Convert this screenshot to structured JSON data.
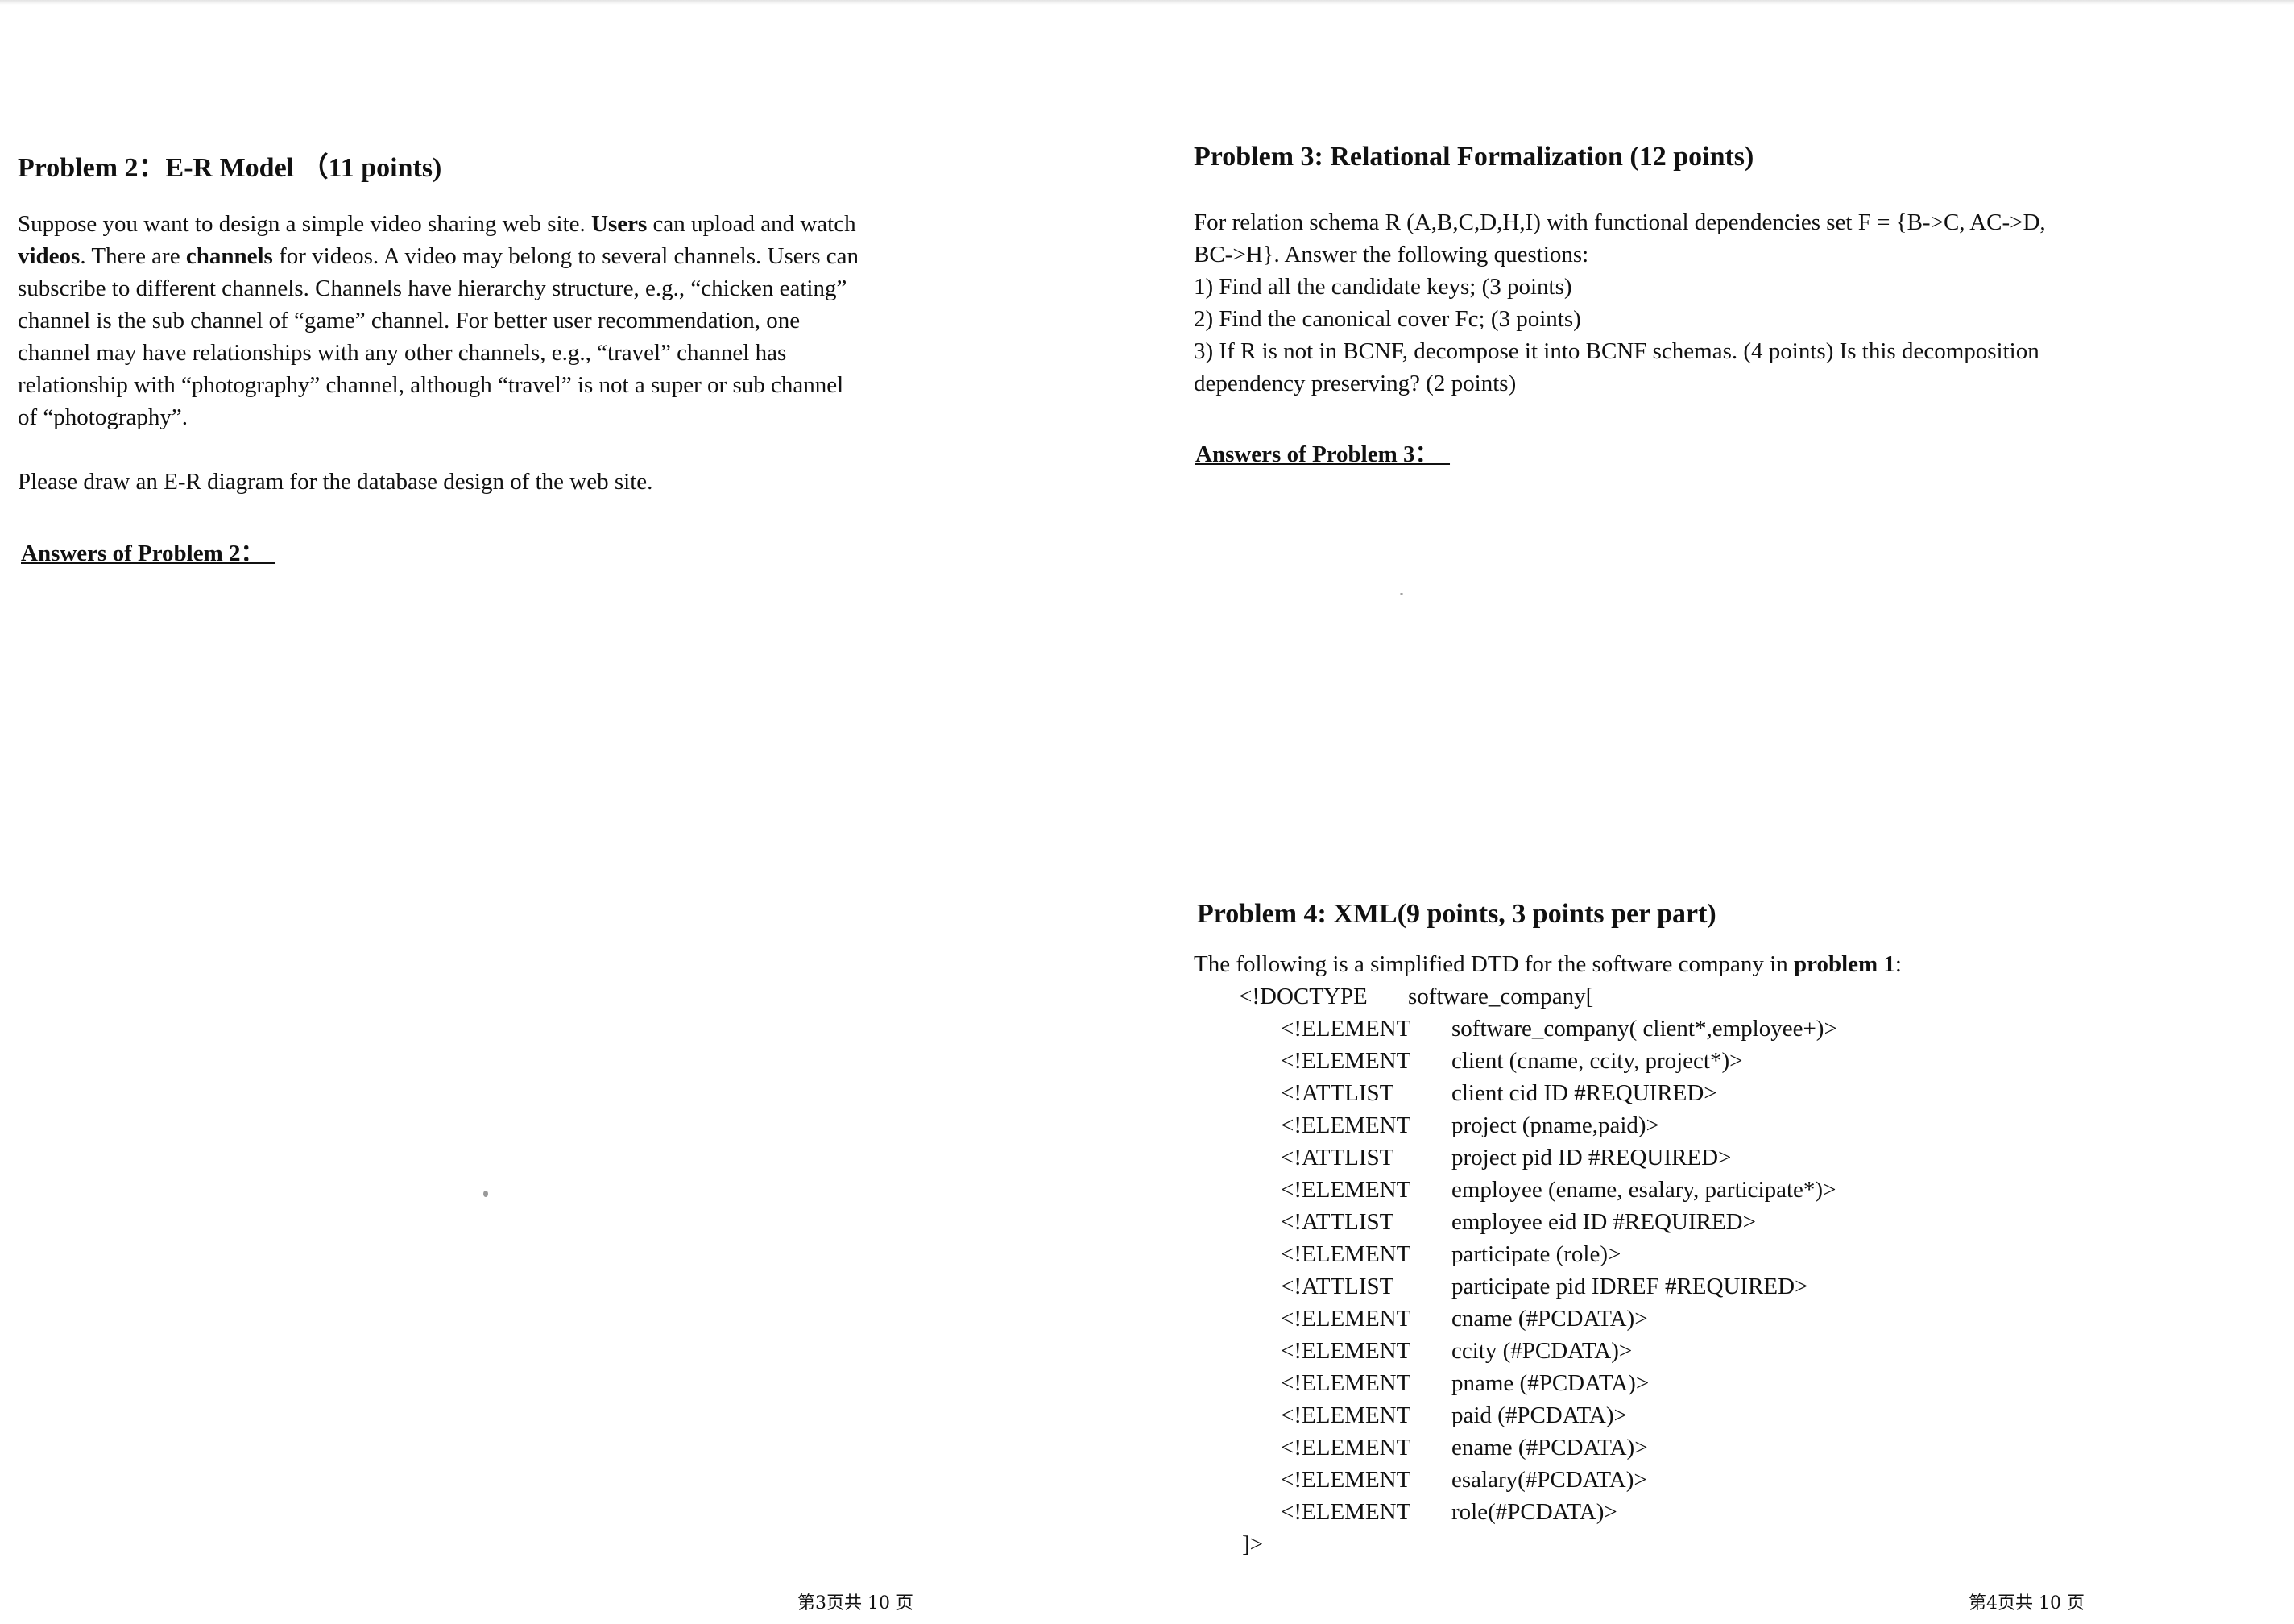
{
  "left_page": {
    "problem2": {
      "heading": "Problem 2：E-R Model （11 points)",
      "lines": [
        [
          {
            "t": "Suppose you want to design a simple video sharing web site. "
          },
          {
            "t": "Users",
            "b": true
          },
          {
            "t": " can upload and watch"
          }
        ],
        [
          {
            "t": "videos",
            "b": true
          },
          {
            "t": ". There are "
          },
          {
            "t": "channels",
            "b": true
          },
          {
            "t": " for videos. A video may belong to several channels. Users can"
          }
        ],
        [
          {
            "t": "subscribe to different channels. Channels have hierarchy structure, e.g., “chicken eating”"
          }
        ],
        [
          {
            "t": "channel is the sub channel of “game” channel. For better user recommendation, one"
          }
        ],
        [
          {
            "t": "channel may have relationships with any other channels, e.g., “travel” channel has"
          }
        ],
        [
          {
            "t": "relationship with “photography” channel, although “travel” is not a super or sub channel"
          }
        ],
        [
          {
            "t": "of “photography”."
          }
        ]
      ],
      "instruction": "Please draw an E-R diagram for the database design of the web site.",
      "answers_label": "Answers of Problem 2：  "
    },
    "footer": "第3页共 10 页"
  },
  "right_page": {
    "problem3": {
      "heading": "Problem 3: Relational Formalization (12 points)",
      "lines": [
        "For relation schema R (A,B,C,D,H,I) with functional dependencies set F = {B->C, AC->D,",
        "BC->H}. Answer the following questions:",
        "1) Find all the candidate keys; (3 points)",
        "2) Find the canonical cover Fc; (3 points)",
        "3) If R is not in BCNF, decompose it into BCNF schemas. (4 points) Is this decomposition",
        "dependency preserving? (2 points)"
      ],
      "answers_label": "Answers of Problem 3：  "
    },
    "problem4": {
      "heading": "Problem 4: XML(9 points, 3 points per part)",
      "intro": [
        {
          "t": "The following is a simplified DTD for the software company in "
        },
        {
          "t": "problem 1",
          "b": true
        },
        {
          "t": ":"
        }
      ],
      "doctype_keyword": "<!DOCTYPE",
      "doctype_name": "software_company[",
      "declarations": [
        {
          "kw": "<!ELEMENT",
          "body": "software_company( client*,employee+)>"
        },
        {
          "kw": "<!ELEMENT",
          "body": "client (cname, ccity, project*)>"
        },
        {
          "kw": "<!ATTLIST",
          "body": "client cid ID #REQUIRED>"
        },
        {
          "kw": "<!ELEMENT",
          "body": "project (pname,paid)>"
        },
        {
          "kw": "<!ATTLIST",
          "body": "project pid ID #REQUIRED>"
        },
        {
          "kw": "<!ELEMENT",
          "body": "employee (ename, esalary, participate*)>"
        },
        {
          "kw": "<!ATTLIST",
          "body": "employee eid ID #REQUIRED>"
        },
        {
          "kw": "<!ELEMENT",
          "body": "participate (role)>"
        },
        {
          "kw": "<!ATTLIST",
          "body": "participate pid IDREF #REQUIRED>"
        },
        {
          "kw": "<!ELEMENT",
          "body": "cname (#PCDATA)>"
        },
        {
          "kw": "<!ELEMENT",
          "body": "ccity (#PCDATA)>"
        },
        {
          "kw": "<!ELEMENT",
          "body": "pname (#PCDATA)>"
        },
        {
          "kw": "<!ELEMENT",
          "body": "paid (#PCDATA)>"
        },
        {
          "kw": "<!ELEMENT",
          "body": "ename (#PCDATA)>"
        },
        {
          "kw": "<!ELEMENT",
          "body": "esalary(#PCDATA)>"
        },
        {
          "kw": "<!ELEMENT",
          "body": "role(#PCDATA)>"
        }
      ],
      "closing": "]>"
    },
    "footer": "第4页共 10 页"
  }
}
